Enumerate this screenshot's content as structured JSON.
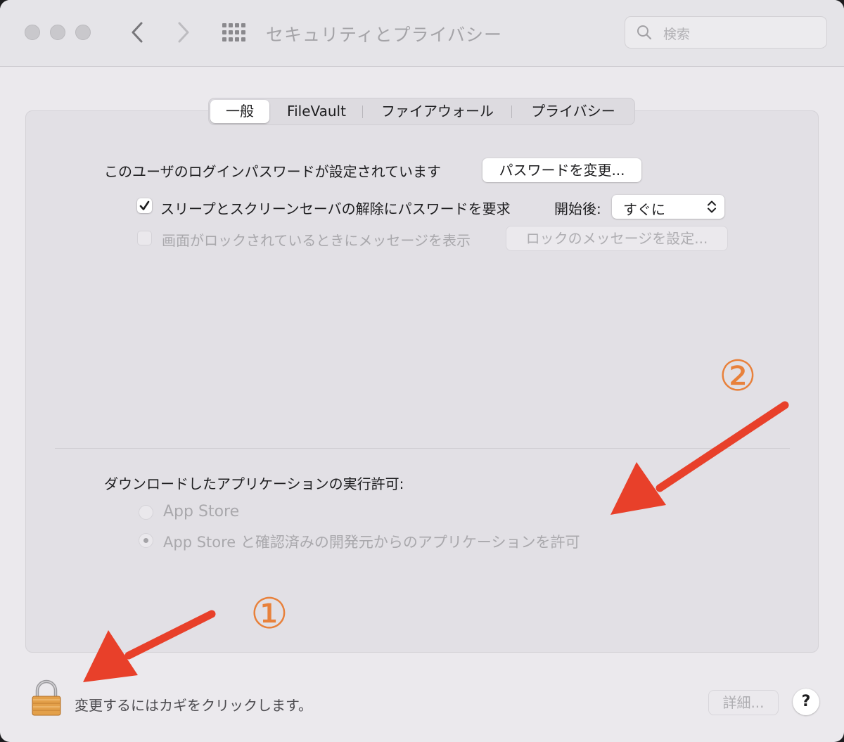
{
  "window": {
    "title": "セキュリティとプライバシー",
    "search_placeholder": "検索"
  },
  "tabs": [
    {
      "label": "一般",
      "active": true
    },
    {
      "label": "FileVault",
      "active": false
    },
    {
      "label": "ファイアウォール",
      "active": false
    },
    {
      "label": "プライバシー",
      "active": false
    }
  ],
  "general": {
    "password_label": "このユーザのログインパスワードが設定されています",
    "change_password_button": "パスワードを変更...",
    "require_password": {
      "label": "スリープとスクリーンセーバの解除にパスワードを要求",
      "checked": true,
      "delay_label": "開始後:",
      "delay_value": "すぐに"
    },
    "lock_message": {
      "label": "画面がロックされているときにメッセージを表示",
      "checked": false,
      "enabled": false,
      "button": "ロックのメッセージを設定..."
    },
    "downloads": {
      "heading": "ダウンロードしたアプリケーションの実行許可:",
      "options": [
        {
          "label": "App Store",
          "selected": false
        },
        {
          "label": "App Store と確認済みの開発元からのアプリケーションを許可",
          "selected": true
        }
      ]
    }
  },
  "annotations": {
    "marker_1": "①",
    "marker_2": "②",
    "color": "#e8813b",
    "arrow_color": "#e8402a"
  },
  "footer": {
    "lock_text": "変更するにはカギをクリックします。",
    "advanced_button": "詳細...",
    "help_button": "?"
  }
}
